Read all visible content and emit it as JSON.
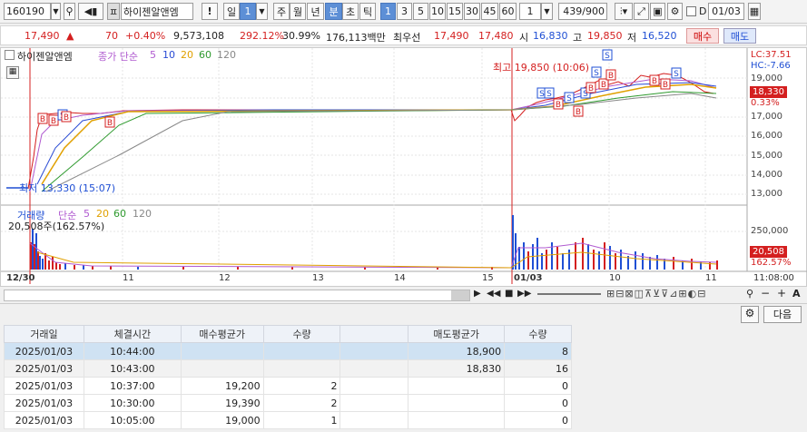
{
  "toolbar": {
    "code": "160190",
    "name": "하이젠알앤엠",
    "excl": "!",
    "period_day": "일",
    "period_num": "1",
    "periods": [
      "주",
      "월",
      "년",
      "분",
      "초",
      "틱"
    ],
    "intervals": [
      "1",
      "3",
      "5",
      "10",
      "15",
      "30",
      "45",
      "60"
    ],
    "spin": "1",
    "counter": "439/900",
    "chk_label": "D",
    "date": "01/03"
  },
  "quote": {
    "price": "17,490",
    "arrow": "▲",
    "change": "70",
    "rate": "+0.40%",
    "volume": "9,573,108",
    "vol_ratio": "292.12%",
    "turnover": "30.99%",
    "amount": "176,113백만",
    "bestlbl": "최우선",
    "ask": "17,490",
    "bid": "17,480",
    "open_label": "시",
    "open": "16,830",
    "high_label": "고",
    "high": "19,850",
    "low_label": "저",
    "low": "16,520",
    "buy": "매수",
    "sell": "매도"
  },
  "price_panel": {
    "title": "하이젠알앤엠",
    "ma_title": "종가 단순",
    "ma_periods": [
      "5",
      "10",
      "20",
      "60",
      "120"
    ],
    "max_label": "최고 19,850 (10:06)",
    "min_label": "최저 13,330 (15:07)",
    "lc": "LC:37.51",
    "hc": "HC:-7.66",
    "cur_tag": "18,330",
    "cur_pct": "0.33%",
    "yticks": [
      "19,000",
      "18,000",
      "17,000",
      "16,000",
      "15,000",
      "14,000",
      "13,000"
    ]
  },
  "vol_panel": {
    "title": "거래량",
    "ma_title": "단순",
    "ma_periods": [
      "5",
      "20",
      "60",
      "120"
    ],
    "info": "20,508주(162.57%)",
    "ytick": "250,000",
    "tag": "20,508",
    "tag_pct": "162.57%"
  },
  "xaxis": {
    "labels": [
      "12/30",
      "11",
      "12",
      "13",
      "14",
      "15",
      "01/03",
      "10",
      "11"
    ],
    "time": "11:08:00"
  },
  "ctl": {
    "zoom_minus": "−",
    "zoom_plus": "+",
    "letter": "A"
  },
  "table": {
    "next": "다음",
    "headers": [
      "거래일",
      "체결시간",
      "매수평균가",
      "수량",
      "",
      "매도평균가",
      "수량"
    ],
    "rows": [
      [
        "2025/01/03",
        "10:44:00",
        "",
        "",
        "",
        "18,900",
        "8"
      ],
      [
        "2025/01/03",
        "10:43:00",
        "",
        "",
        "",
        "18,830",
        "16"
      ],
      [
        "2025/01/03",
        "10:37:00",
        "19,200",
        "2",
        "",
        "",
        "0"
      ],
      [
        "2025/01/03",
        "10:30:00",
        "19,390",
        "2",
        "",
        "",
        "0"
      ],
      [
        "2025/01/03",
        "10:05:00",
        "19,000",
        "1",
        "",
        "",
        "0"
      ]
    ]
  },
  "colors": {
    "up": "#d41f1f",
    "down": "#1f4fd4",
    "ma5": "#b05ad0",
    "ma10": "#2a4bd4",
    "ma20": "#e0a000",
    "ma60": "#2e9a2e",
    "ma120": "#888888"
  }
}
